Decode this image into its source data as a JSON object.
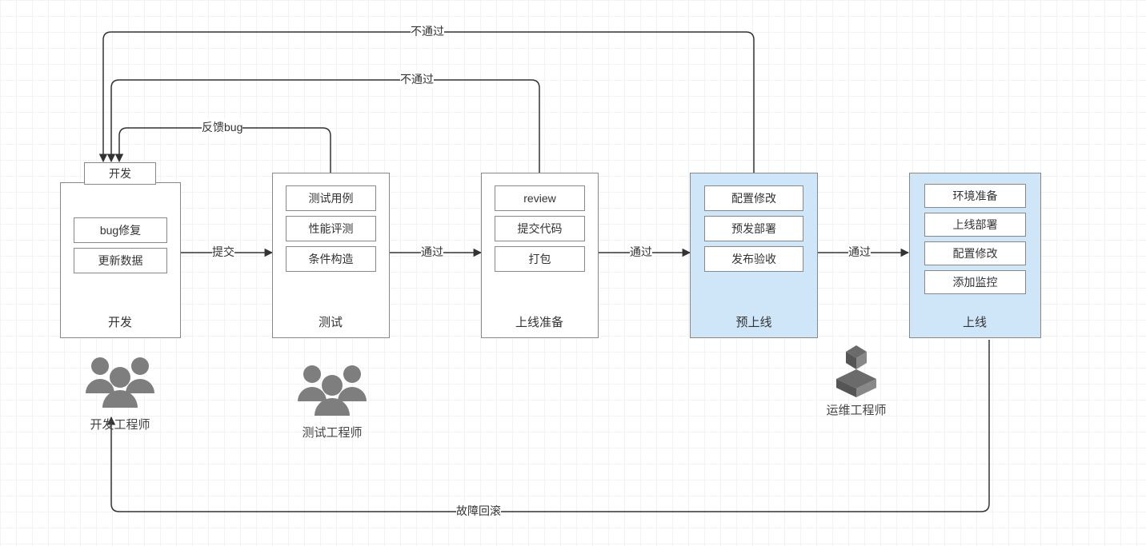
{
  "stages": {
    "dev": {
      "title": "开发",
      "header": "开发",
      "items": [
        "bug修复",
        "更新数据"
      ]
    },
    "test": {
      "title": "测试",
      "items": [
        "测试用例",
        "性能评测",
        "条件构造"
      ]
    },
    "prep": {
      "title": "上线准备",
      "items": [
        "review",
        "提交代码",
        "打包"
      ]
    },
    "pre": {
      "title": "预上线",
      "items": [
        "配置修改",
        "预发部署",
        "发布验收"
      ]
    },
    "online": {
      "title": "上线",
      "items": [
        "环境准备",
        "上线部署",
        "配置修改",
        "添加监控"
      ]
    }
  },
  "edges": {
    "submit": "提交",
    "pass1": "通过",
    "pass2": "通过",
    "pass3": "通过",
    "feedback_bug": "反馈bug",
    "fail1": "不通过",
    "fail2": "不通过",
    "rollback": "故障回滚"
  },
  "roles": {
    "dev": "开发工程师",
    "test": "测试工程师",
    "ops": "运维工程师"
  }
}
